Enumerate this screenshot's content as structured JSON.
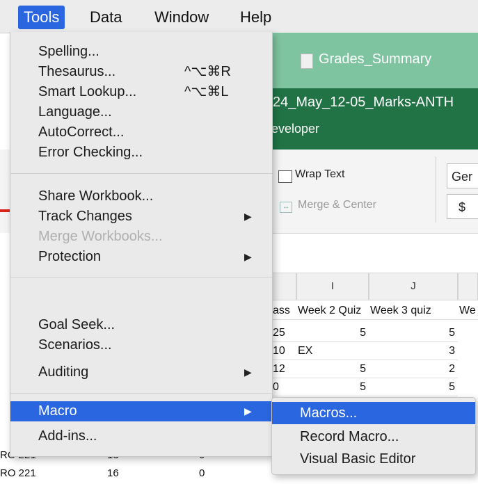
{
  "menubar": {
    "items": [
      {
        "label": "Tools"
      },
      {
        "label": "Data"
      },
      {
        "label": "Window"
      },
      {
        "label": "Help"
      }
    ]
  },
  "excel": {
    "doc_title": "Grades_Summary",
    "file_name": "24_May_12-05_Marks-ANTH",
    "ribbon_tab": "eveloper",
    "wrap_text": "Wrap Text",
    "merge_center": "Merge & Center",
    "format_box": "Ger",
    "currency_symbol": "$",
    "columns": [
      "I",
      "J"
    ],
    "headers": [
      "ass",
      "Week 2 Quiz",
      "Week 3 quiz",
      "We"
    ],
    "rows": [
      [
        "25",
        "5",
        "5"
      ],
      [
        "10",
        "EX",
        "3"
      ],
      [
        "12",
        "5",
        "2"
      ],
      [
        "0",
        "5",
        "5"
      ]
    ],
    "bottom_rows": [
      [
        "RO 221",
        "13",
        "0"
      ],
      [
        "RO 221",
        "16",
        "0"
      ]
    ]
  },
  "tools_menu": {
    "items": [
      {
        "label": "Spelling...",
        "shortcut": ""
      },
      {
        "label": "Thesaurus...",
        "shortcut": "^⌥⌘R"
      },
      {
        "label": "Smart Lookup...",
        "shortcut": "^⌥⌘L"
      },
      {
        "label": "Language...",
        "shortcut": ""
      },
      {
        "label": "AutoCorrect...",
        "shortcut": ""
      },
      {
        "label": "Error Checking...",
        "shortcut": ""
      },
      {
        "label": "Share Workbook...",
        "shortcut": ""
      },
      {
        "label": "Track Changes",
        "shortcut": ""
      },
      {
        "label": "Merge Workbooks...",
        "shortcut": ""
      },
      {
        "label": "Protection",
        "shortcut": ""
      },
      {
        "label": "Goal Seek...",
        "shortcut": ""
      },
      {
        "label": "Scenarios...",
        "shortcut": ""
      },
      {
        "label": "Auditing",
        "shortcut": ""
      },
      {
        "label": "Macro",
        "shortcut": ""
      },
      {
        "label": "Add-ins...",
        "shortcut": ""
      }
    ],
    "submenu_arrow": "▶"
  },
  "macro_submenu": {
    "items": [
      {
        "label": "Macros..."
      },
      {
        "label": "Record Macro..."
      },
      {
        "label": "Visual Basic Editor"
      }
    ]
  }
}
